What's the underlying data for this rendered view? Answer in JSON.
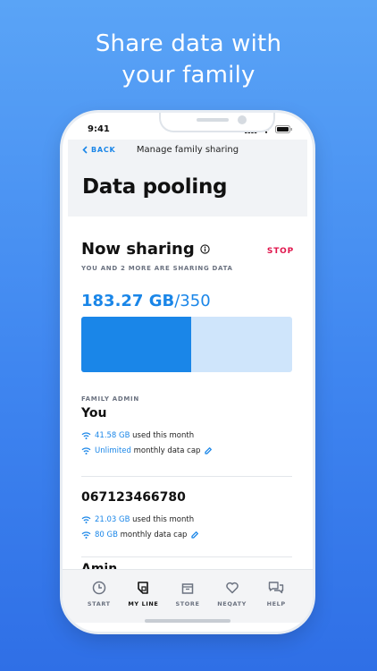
{
  "headline": [
    "Share data with",
    "your family"
  ],
  "status_bar": {
    "time": "9:41"
  },
  "nav": {
    "back_label": "BACK",
    "title": "Manage family sharing"
  },
  "page_title": "Data pooling",
  "sharing": {
    "title": "Now sharing",
    "stop_label": "STOP",
    "subtitle": "YOU AND 2 MORE ARE SHARING DATA",
    "used": "183.27 GB",
    "total": "/350",
    "fill_fraction": 0.52
  },
  "members": [
    {
      "role": "FAMILY ADMIN",
      "name": "You",
      "stats": [
        {
          "highlight": "41.58 GB",
          "text": " used this month",
          "editable": false
        },
        {
          "highlight": "Unlimited",
          "text": " monthly data cap",
          "editable": true
        }
      ]
    },
    {
      "role": "",
      "name": "067123466780",
      "stats": [
        {
          "highlight": "21.03 GB",
          "text": " used this month",
          "editable": false
        },
        {
          "highlight": "80 GB",
          "text": " monthly data cap",
          "editable": true
        }
      ]
    },
    {
      "role": "",
      "name": "Amin",
      "stats": []
    }
  ],
  "tabs": [
    {
      "label": "START",
      "icon": "clock-icon",
      "active": false
    },
    {
      "label": "MY LINE",
      "icon": "sim-card-icon",
      "active": true
    },
    {
      "label": "STORE",
      "icon": "shopping-bag-icon",
      "active": false
    },
    {
      "label": "NEQATY",
      "icon": "heart-icon",
      "active": false
    },
    {
      "label": "HELP",
      "icon": "chat-bubbles-icon",
      "active": false
    }
  ],
  "colors": {
    "accent": "#1a86e8",
    "stop": "#e0154c",
    "bar_track": "#cfe5fb"
  }
}
